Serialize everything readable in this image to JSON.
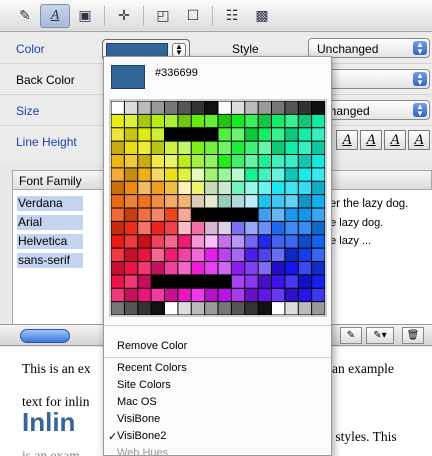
{
  "props": {
    "color_label": "Color",
    "back_color_label": "Back Color",
    "size_label": "Size",
    "line_height_label": "Line Height",
    "style_label": "Style",
    "style_value": "Unchanged",
    "weight_value_partial": "ld",
    "size_value_partial": "nchanged"
  },
  "colors": {
    "current": "#336699",
    "accent": "#2f62c8"
  },
  "format_buttons": [
    "A",
    "A",
    "A",
    "A"
  ],
  "font_family": {
    "header": "Font Family",
    "items": [
      "Verdana",
      "Arial",
      "Helvetica",
      "sans-serif"
    ]
  },
  "preview": {
    "lines": [
      "ver the lazy dog.",
      "he lazy dog.",
      "he lazy ..."
    ]
  },
  "document": {
    "line1_start": "This is an ex",
    "line1_end": "an example",
    "line2_start": "text for inlin",
    "big_word": "Inlin",
    "line3_end": "e styles. This",
    "line4_start": "is an exam"
  },
  "dropdown": {
    "hex": "#336699",
    "remove": "Remove Color",
    "recent": "Recent Colors",
    "site": "Site Colors",
    "macos": "Mac OS",
    "visibone": "VisiBone",
    "visibone2": "VisiBone2",
    "webhues": "Web Hues"
  },
  "icons": {
    "toolbar": [
      "pencil-icon",
      "text-style-icon",
      "image-icon",
      "move-icon",
      "frame-icon",
      "box-icon",
      "list-icon",
      "pattern-icon"
    ],
    "bottom": [
      "edit-icon",
      "edit-menu-icon",
      "trash-icon"
    ]
  }
}
